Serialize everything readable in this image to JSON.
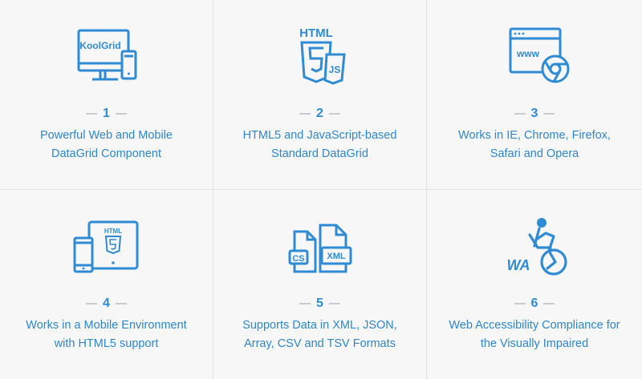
{
  "features": [
    {
      "number": "1",
      "line1": "Powerful Web and Mobile",
      "line2": "DataGrid Component",
      "icon": "devices-koolgrid-icon",
      "icon_text": "KoolGrid"
    },
    {
      "number": "2",
      "line1": "HTML5 and JavaScript-based",
      "line2": "Standard DataGrid",
      "icon": "html5-js-icon",
      "icon_text": "HTML",
      "icon_text2": "JS"
    },
    {
      "number": "3",
      "line1": "Works in IE, Chrome, Firefox,",
      "line2": "Safari and Opera",
      "icon": "browser-window-icon",
      "icon_text": "www"
    },
    {
      "number": "4",
      "line1": "Works in a Mobile Environment",
      "line2": "with HTML5 support",
      "icon": "mobile-html5-icon",
      "icon_text": "HTML"
    },
    {
      "number": "5",
      "line1": "Supports Data in XML, JSON,",
      "line2": "Array, CSV and TSV Formats",
      "icon": "data-files-icon",
      "icon_text": "CS",
      "icon_text2": "XML"
    },
    {
      "number": "6",
      "line1": "Web Accessibility Compliance for",
      "line2": "the Visually Impaired",
      "icon": "web-accessibility-icon",
      "icon_text": "WA"
    }
  ],
  "colors": {
    "accent": "#2f8bd4",
    "background": "#f7f7f8",
    "divider": "#e2e3e6"
  }
}
